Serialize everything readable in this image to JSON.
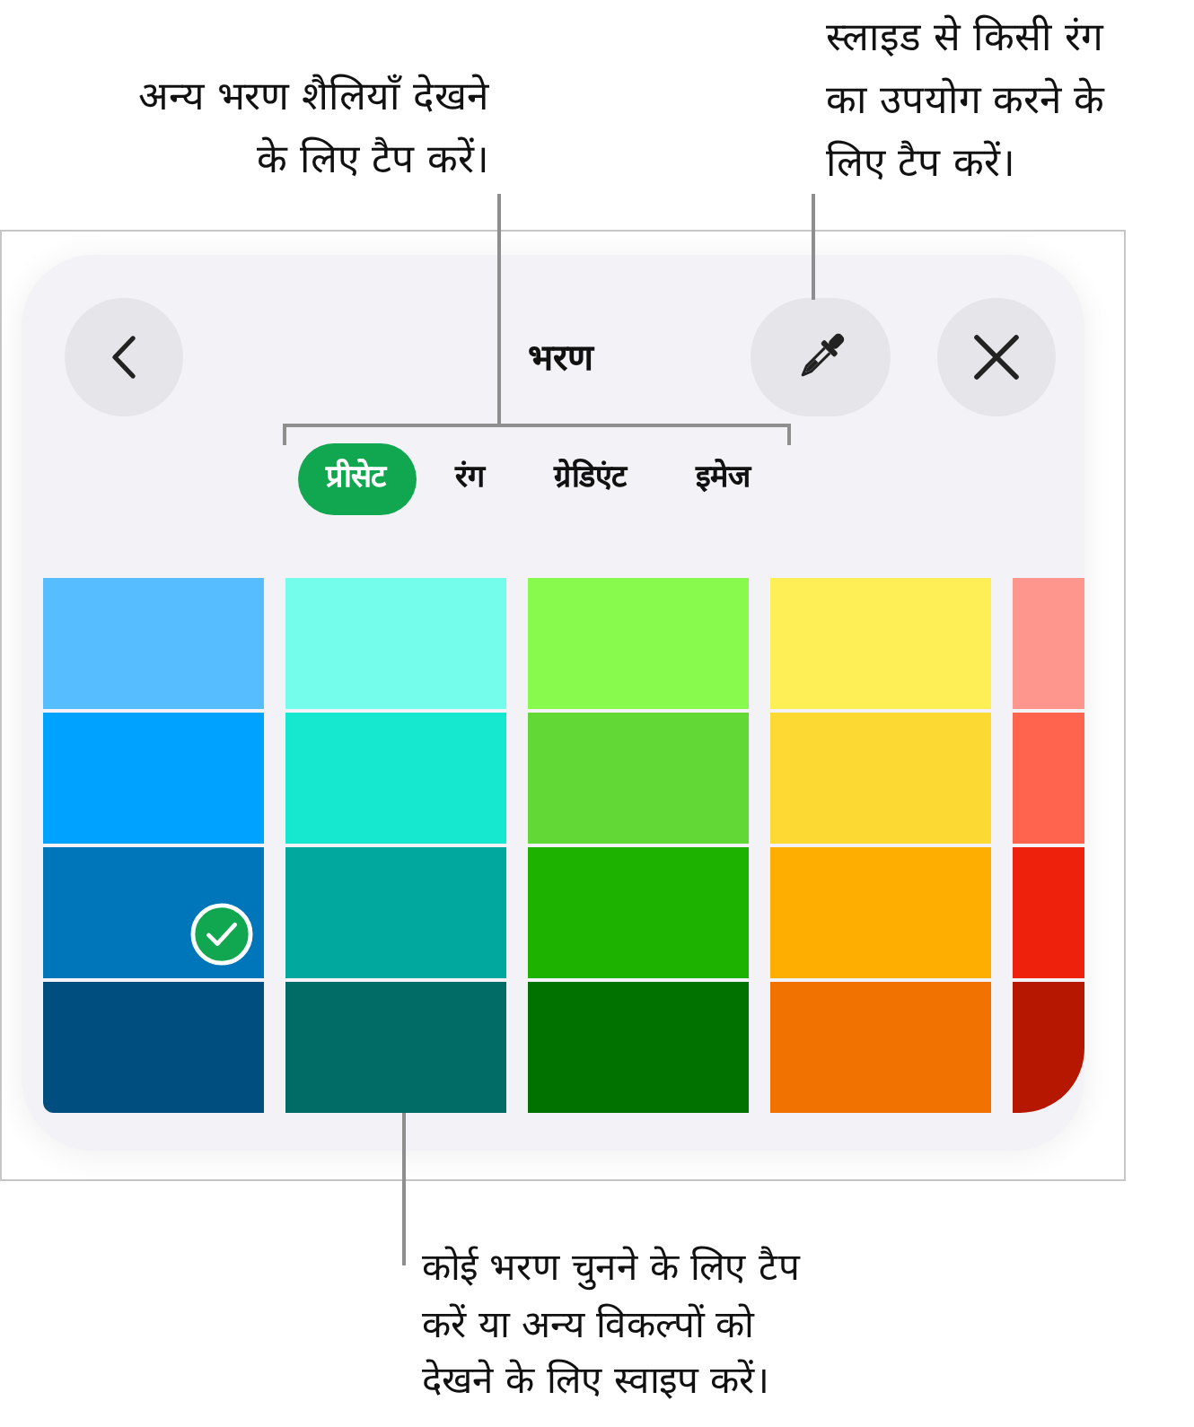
{
  "top_callouts": [
    {
      "kind": "tabs",
      "text": "अन्य भरण शैलियाँ देखने\nके लिए टैप करें।"
    },
    {
      "kind": "eyedropper",
      "text": "स्लाइड से किसी रंग\nका उपयोग करने के\nलिए टैप करें।"
    }
  ],
  "panel": {
    "title": "भरण",
    "tabs": [
      {
        "label": "प्रीसेट",
        "selected": true
      },
      {
        "label": "रंग",
        "selected": false
      },
      {
        "label": "ग्रेडिएंट",
        "selected": false
      },
      {
        "label": "इमेज",
        "selected": false
      }
    ],
    "swatch_columns": [
      {
        "swatches": [
          {
            "color": "#56befe",
            "selected": false
          },
          {
            "color": "#00a2ff",
            "selected": false
          },
          {
            "color": "#0076ba",
            "selected": true
          },
          {
            "color": "#004d80",
            "selected": false
          }
        ]
      },
      {
        "swatches": [
          {
            "color": "#73fdea",
            "selected": false
          },
          {
            "color": "#16e7cf",
            "selected": false
          },
          {
            "color": "#00a89d",
            "selected": false
          },
          {
            "color": "#006c65",
            "selected": false
          }
        ]
      },
      {
        "swatches": [
          {
            "color": "#88fa4e",
            "selected": false
          },
          {
            "color": "#61d836",
            "selected": false
          },
          {
            "color": "#1db100",
            "selected": false
          },
          {
            "color": "#017100",
            "selected": false
          }
        ]
      },
      {
        "swatches": [
          {
            "color": "#ffef57",
            "selected": false
          },
          {
            "color": "#fdd933",
            "selected": false
          },
          {
            "color": "#feae00",
            "selected": false
          },
          {
            "color": "#f27200",
            "selected": false
          }
        ]
      },
      {
        "swatches": [
          {
            "color": "#ff968d",
            "selected": false
          },
          {
            "color": "#ff644e",
            "selected": false
          },
          {
            "color": "#ee220c",
            "selected": false
          },
          {
            "color": "#b51700",
            "selected": false
          }
        ]
      }
    ]
  },
  "bottom_callout": {
    "kind": "swatches",
    "text": "कोई भरण चुनने के लिए टैप\nकरें या अन्य विकल्पों को\nदेखने के लिए स्वाइप करें।"
  }
}
